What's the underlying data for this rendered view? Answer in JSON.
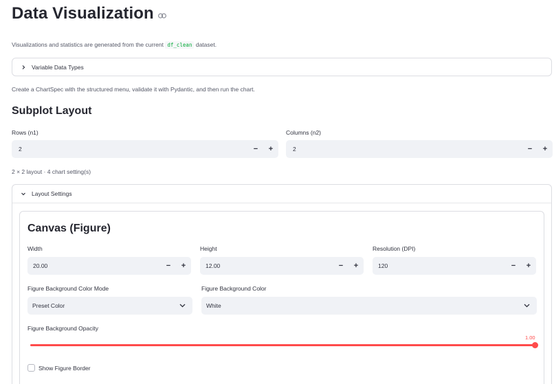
{
  "page": {
    "title": "Data Visualization",
    "caption_prefix": "Visualizations and statistics are generated from the current",
    "caption_code": "df_clean",
    "caption_suffix": "dataset.",
    "variable_types_expander": "Variable Data Types",
    "chartspec_caption": "Create a ChartSpec with the structured menu, validate it with Pydantic, and then run the chart."
  },
  "subplot": {
    "heading": "Subplot Layout",
    "rows_label": "Rows (n1)",
    "rows_value": "2",
    "cols_label": "Columns (n2)",
    "cols_value": "2",
    "summary": "2 × 2 layout · 4 chart setting(s)"
  },
  "layout_settings": {
    "expander": "Layout Settings",
    "canvas_heading": "Canvas (Figure)",
    "width_label": "Width",
    "width_value": "20.00",
    "height_label": "Height",
    "height_value": "12.00",
    "dpi_label": "Resolution (DPI)",
    "dpi_value": "120",
    "bg_mode_label": "Figure Background Color Mode",
    "bg_mode_value": "Preset Color",
    "bg_color_label": "Figure Background Color",
    "bg_color_value": "White",
    "opacity_label": "Figure Background Opacity",
    "opacity_value": "1.00",
    "opacity_fraction": 1.0,
    "border_label": "Show Figure Border",
    "border_checked": false
  },
  "icons": {
    "minus": "−",
    "plus": "+"
  },
  "colors": {
    "accent": "#ff4b4b",
    "input_bg": "#f0f2f6",
    "code_text": "#09ab3b"
  }
}
